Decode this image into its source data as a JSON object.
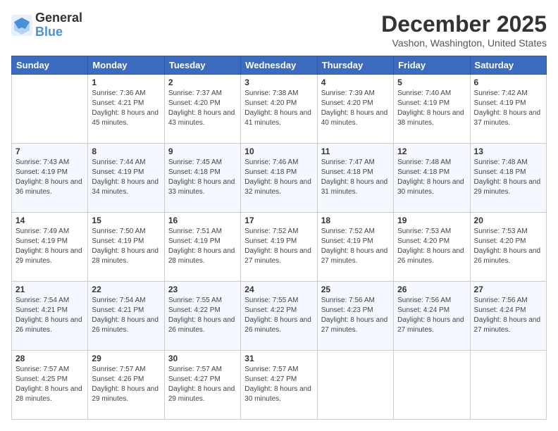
{
  "header": {
    "logo_general": "General",
    "logo_blue": "Blue",
    "month_title": "December 2025",
    "location": "Vashon, Washington, United States"
  },
  "weekdays": [
    "Sunday",
    "Monday",
    "Tuesday",
    "Wednesday",
    "Thursday",
    "Friday",
    "Saturday"
  ],
  "weeks": [
    [
      {
        "day": "",
        "sunrise": "",
        "sunset": "",
        "daylight": ""
      },
      {
        "day": "1",
        "sunrise": "Sunrise: 7:36 AM",
        "sunset": "Sunset: 4:21 PM",
        "daylight": "Daylight: 8 hours and 45 minutes."
      },
      {
        "day": "2",
        "sunrise": "Sunrise: 7:37 AM",
        "sunset": "Sunset: 4:20 PM",
        "daylight": "Daylight: 8 hours and 43 minutes."
      },
      {
        "day": "3",
        "sunrise": "Sunrise: 7:38 AM",
        "sunset": "Sunset: 4:20 PM",
        "daylight": "Daylight: 8 hours and 41 minutes."
      },
      {
        "day": "4",
        "sunrise": "Sunrise: 7:39 AM",
        "sunset": "Sunset: 4:20 PM",
        "daylight": "Daylight: 8 hours and 40 minutes."
      },
      {
        "day": "5",
        "sunrise": "Sunrise: 7:40 AM",
        "sunset": "Sunset: 4:19 PM",
        "daylight": "Daylight: 8 hours and 38 minutes."
      },
      {
        "day": "6",
        "sunrise": "Sunrise: 7:42 AM",
        "sunset": "Sunset: 4:19 PM",
        "daylight": "Daylight: 8 hours and 37 minutes."
      }
    ],
    [
      {
        "day": "7",
        "sunrise": "Sunrise: 7:43 AM",
        "sunset": "Sunset: 4:19 PM",
        "daylight": "Daylight: 8 hours and 36 minutes."
      },
      {
        "day": "8",
        "sunrise": "Sunrise: 7:44 AM",
        "sunset": "Sunset: 4:19 PM",
        "daylight": "Daylight: 8 hours and 34 minutes."
      },
      {
        "day": "9",
        "sunrise": "Sunrise: 7:45 AM",
        "sunset": "Sunset: 4:18 PM",
        "daylight": "Daylight: 8 hours and 33 minutes."
      },
      {
        "day": "10",
        "sunrise": "Sunrise: 7:46 AM",
        "sunset": "Sunset: 4:18 PM",
        "daylight": "Daylight: 8 hours and 32 minutes."
      },
      {
        "day": "11",
        "sunrise": "Sunrise: 7:47 AM",
        "sunset": "Sunset: 4:18 PM",
        "daylight": "Daylight: 8 hours and 31 minutes."
      },
      {
        "day": "12",
        "sunrise": "Sunrise: 7:48 AM",
        "sunset": "Sunset: 4:18 PM",
        "daylight": "Daylight: 8 hours and 30 minutes."
      },
      {
        "day": "13",
        "sunrise": "Sunrise: 7:48 AM",
        "sunset": "Sunset: 4:18 PM",
        "daylight": "Daylight: 8 hours and 29 minutes."
      }
    ],
    [
      {
        "day": "14",
        "sunrise": "Sunrise: 7:49 AM",
        "sunset": "Sunset: 4:19 PM",
        "daylight": "Daylight: 8 hours and 29 minutes."
      },
      {
        "day": "15",
        "sunrise": "Sunrise: 7:50 AM",
        "sunset": "Sunset: 4:19 PM",
        "daylight": "Daylight: 8 hours and 28 minutes."
      },
      {
        "day": "16",
        "sunrise": "Sunrise: 7:51 AM",
        "sunset": "Sunset: 4:19 PM",
        "daylight": "Daylight: 8 hours and 28 minutes."
      },
      {
        "day": "17",
        "sunrise": "Sunrise: 7:52 AM",
        "sunset": "Sunset: 4:19 PM",
        "daylight": "Daylight: 8 hours and 27 minutes."
      },
      {
        "day": "18",
        "sunrise": "Sunrise: 7:52 AM",
        "sunset": "Sunset: 4:19 PM",
        "daylight": "Daylight: 8 hours and 27 minutes."
      },
      {
        "day": "19",
        "sunrise": "Sunrise: 7:53 AM",
        "sunset": "Sunset: 4:20 PM",
        "daylight": "Daylight: 8 hours and 26 minutes."
      },
      {
        "day": "20",
        "sunrise": "Sunrise: 7:53 AM",
        "sunset": "Sunset: 4:20 PM",
        "daylight": "Daylight: 8 hours and 26 minutes."
      }
    ],
    [
      {
        "day": "21",
        "sunrise": "Sunrise: 7:54 AM",
        "sunset": "Sunset: 4:21 PM",
        "daylight": "Daylight: 8 hours and 26 minutes."
      },
      {
        "day": "22",
        "sunrise": "Sunrise: 7:54 AM",
        "sunset": "Sunset: 4:21 PM",
        "daylight": "Daylight: 8 hours and 26 minutes."
      },
      {
        "day": "23",
        "sunrise": "Sunrise: 7:55 AM",
        "sunset": "Sunset: 4:22 PM",
        "daylight": "Daylight: 8 hours and 26 minutes."
      },
      {
        "day": "24",
        "sunrise": "Sunrise: 7:55 AM",
        "sunset": "Sunset: 4:22 PM",
        "daylight": "Daylight: 8 hours and 26 minutes."
      },
      {
        "day": "25",
        "sunrise": "Sunrise: 7:56 AM",
        "sunset": "Sunset: 4:23 PM",
        "daylight": "Daylight: 8 hours and 27 minutes."
      },
      {
        "day": "26",
        "sunrise": "Sunrise: 7:56 AM",
        "sunset": "Sunset: 4:24 PM",
        "daylight": "Daylight: 8 hours and 27 minutes."
      },
      {
        "day": "27",
        "sunrise": "Sunrise: 7:56 AM",
        "sunset": "Sunset: 4:24 PM",
        "daylight": "Daylight: 8 hours and 27 minutes."
      }
    ],
    [
      {
        "day": "28",
        "sunrise": "Sunrise: 7:57 AM",
        "sunset": "Sunset: 4:25 PM",
        "daylight": "Daylight: 8 hours and 28 minutes."
      },
      {
        "day": "29",
        "sunrise": "Sunrise: 7:57 AM",
        "sunset": "Sunset: 4:26 PM",
        "daylight": "Daylight: 8 hours and 29 minutes."
      },
      {
        "day": "30",
        "sunrise": "Sunrise: 7:57 AM",
        "sunset": "Sunset: 4:27 PM",
        "daylight": "Daylight: 8 hours and 29 minutes."
      },
      {
        "day": "31",
        "sunrise": "Sunrise: 7:57 AM",
        "sunset": "Sunset: 4:27 PM",
        "daylight": "Daylight: 8 hours and 30 minutes."
      },
      {
        "day": "",
        "sunrise": "",
        "sunset": "",
        "daylight": ""
      },
      {
        "day": "",
        "sunrise": "",
        "sunset": "",
        "daylight": ""
      },
      {
        "day": "",
        "sunrise": "",
        "sunset": "",
        "daylight": ""
      }
    ]
  ]
}
